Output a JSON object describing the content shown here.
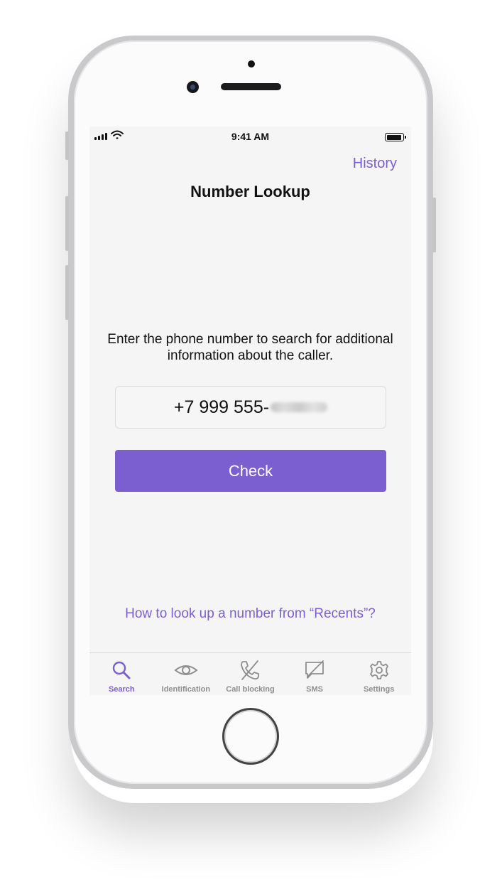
{
  "status_bar": {
    "time": "9:41 AM"
  },
  "header": {
    "history_link": "History",
    "title": "Number Lookup"
  },
  "main": {
    "instructions": "Enter the phone number to search for additional information about the caller.",
    "phone_value": "+7 999 555-",
    "check_button": "Check",
    "recents_link": "How to look up a number from “Recents”?"
  },
  "tabs": [
    {
      "label": "Search",
      "icon": "search-icon",
      "active": true
    },
    {
      "label": "Identification",
      "icon": "eye-icon",
      "active": false
    },
    {
      "label": "Call blocking",
      "icon": "phone-slash-icon",
      "active": false
    },
    {
      "label": "SMS",
      "icon": "message-slash-icon",
      "active": false
    },
    {
      "label": "Settings",
      "icon": "gear-icon",
      "active": false
    }
  ],
  "colors": {
    "accent": "#7B5FD1",
    "inactive": "#8e8e8e",
    "background": "#f5f5f5"
  }
}
